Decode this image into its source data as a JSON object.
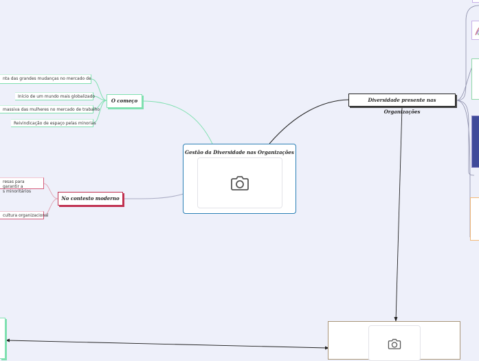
{
  "central": {
    "title": "Gestão da Diversidade nas Organizações"
  },
  "branches": {
    "o_comeco": {
      "label": "O começo",
      "items": [
        "nta das grandes mudanças no mercado de",
        "Início de um mundo mais globalizado",
        "massiva das mulheres no mercado de trabalho",
        "Reivindicação de espaço pelas minorias"
      ]
    },
    "no_contesto_moderno": {
      "label": "No contesto moderno",
      "items": [
        "resas para garantir a",
        "s minoritários",
        "cultura organizacional"
      ]
    },
    "diversidade_presente": {
      "label": "Diversidade presente nas Organizações"
    }
  },
  "colors": {
    "green_link": "#7fe0b0",
    "red_border": "#c0304f",
    "blue_border": "#2a7fb5",
    "dark_link": "#222222",
    "gray_link": "#a9abc3"
  },
  "icons": [
    "camera-icon"
  ]
}
